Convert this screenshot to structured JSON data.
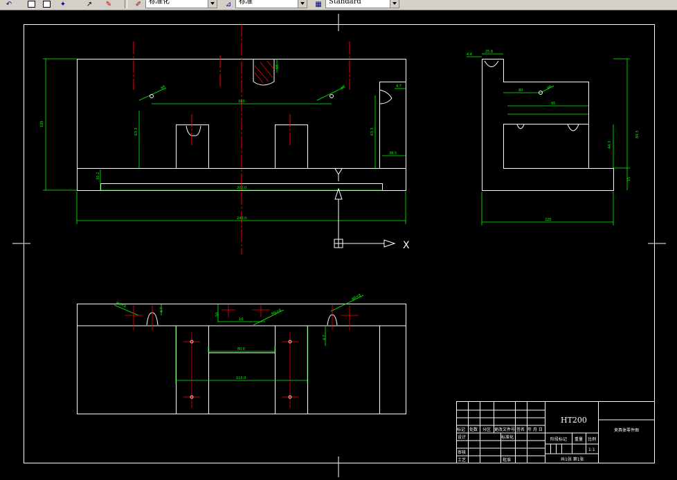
{
  "toolbar": {
    "layer_combo": "标准化",
    "dimstyle_combo": "标准",
    "textstyle_combo": "Standard",
    "icons": [
      "undo-icon",
      "select-icon",
      "window-icon",
      "properties-icon",
      "pointer-icon",
      "erase-icon"
    ]
  },
  "drawing": {
    "axis_x": "X",
    "axis_y": "Y",
    "front_view": {
      "dim_width_total": "240.0",
      "dim_inner": "200.0",
      "dim_hole_spacing": "160",
      "dim_height": "105",
      "dim_left_h": "63.3",
      "dim_right_h": "63.3",
      "dim_base": "16.2",
      "dim_r": "4.7",
      "dim_slot": "38.5",
      "dim_top_slot": "10",
      "dim_hole_l": "φ6",
      "dim_hole_r": "φ6"
    },
    "side_view": {
      "dim_bottom": "220",
      "dim_top_small": "25.6",
      "dim_top_offset": "4.4",
      "dim_upper": "80",
      "dim_mid": "95",
      "dim_height": "84.3",
      "dim_inner_h": "44.3",
      "dim_small_h": "15",
      "dim_hole": "φ6"
    },
    "top_view": {
      "dim_inner_w": "80.0",
      "dim_outer_w": "110.0",
      "dim_slot": "10",
      "dim_ang_1": "M6×8",
      "dim_ang_2": "M6×8",
      "dim_ang_3": "φ6×8",
      "dim_h1": "4.7",
      "dim_h2": "4.7",
      "dim_v": "10"
    },
    "title_block": {
      "material": "HT200",
      "part_name": "夹具体零件图",
      "row_labels": [
        "标记",
        "处数",
        "分区",
        "更改文件号",
        "签名",
        "年 月 日"
      ],
      "left_rows": [
        "设计",
        "审核",
        "工艺"
      ],
      "mid_labels": [
        "标准化",
        "批准"
      ],
      "right_labels": [
        "阶段标记",
        "重量",
        "比例"
      ],
      "scale": "1:1",
      "sheet": "共1张 第1张"
    }
  }
}
